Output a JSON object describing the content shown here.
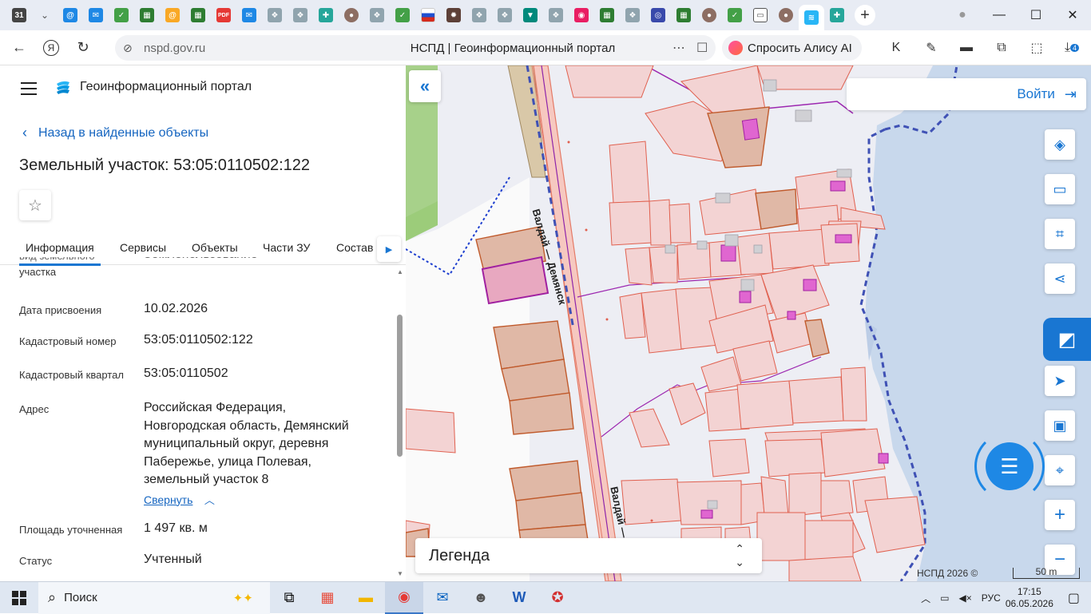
{
  "browser": {
    "tab_date": "31",
    "url": "nspd.gov.ru",
    "page_title": "НСПД | Геоинформационный портал",
    "alice_label": "Спросить Алису AI",
    "downloads_badge": "4"
  },
  "portal": {
    "name": "Геоинформационный портал",
    "back_link": "Назад в найденные объекты",
    "object_title": "Земельный участок: 53:05:0110502:122",
    "tabs": [
      "Информация",
      "Сервисы",
      "Объекты",
      "Части ЗУ",
      "Состав"
    ]
  },
  "attributes": {
    "cut_label": "Вид разрешенного использования земельного участка",
    "cut_label_visible": "участка",
    "cut_value": "Землепользование",
    "date_label": "Дата присвоения",
    "date_value": "10.02.2026",
    "cad_num_label": "Кадастровый номер",
    "cad_num_value": "53:05:0110502:122",
    "cad_quarter_label": "Кадастровый квартал",
    "cad_quarter_value": "53:05:0110502",
    "address_label": "Адрес",
    "address_lines": [
      "Российская Федерация,",
      "Новгородская область, Демянский",
      "муниципальный округ, деревня",
      "Паберeжье, улица Полевая,",
      "земельный участок 8"
    ],
    "collapse_label": "Свернуть",
    "area_label": "Площадь уточненная",
    "area_value": "1 497 кв. м",
    "status_label": "Статус",
    "status_value": "Учтенный"
  },
  "map": {
    "login_label": "Войти",
    "legend_label": "Легенда",
    "copyright": "НСПД 2026 ©",
    "scale_label": "50 m",
    "road_label_1": "Валдай — Демянск",
    "road_label_2": "Валдай —"
  },
  "taskbar": {
    "search_label": "Поиск",
    "lang": "РУС",
    "time": "17:15",
    "date": "06.05.2026"
  },
  "colors": {
    "accent": "#1976d2",
    "parcel_fill": "#f3d3d3",
    "parcel_stroke": "#e0604f",
    "selected_fill": "#e0b8a6",
    "water": "#c8d8ec"
  }
}
